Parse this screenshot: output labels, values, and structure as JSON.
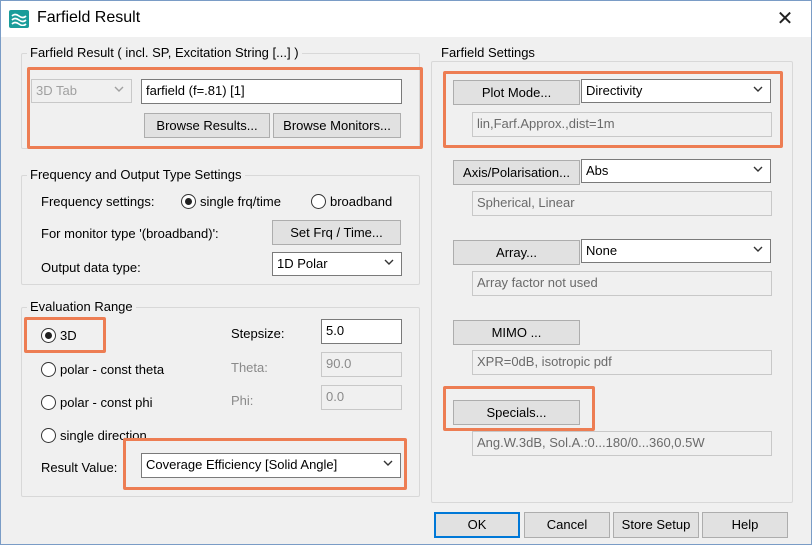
{
  "window": {
    "title": "Farfield Result",
    "app_icon": "wave-icon",
    "close_icon": "close-icon",
    "close_glyph": "✕"
  },
  "farfield_result": {
    "group_title": "Farfield Result ( incl. SP, Excitation String [...] )",
    "tab_combo_value": "3D Tab",
    "result_name": "farfield (f=.81) [1]",
    "browse_results_label": "Browse Results...",
    "browse_monitors_label": "Browse Monitors..."
  },
  "frequency_output": {
    "group_title": "Frequency and Output Type Settings",
    "frequency_label": "Frequency settings:",
    "single_label": "single frq/time",
    "broadband_label": "broadband",
    "single_selected": true,
    "monitor_label": "For monitor type '(broadband)':",
    "set_frq_label": "Set Frq / Time...",
    "output_type_label": "Output data type:",
    "output_type_value": "1D Polar"
  },
  "evaluation_range": {
    "group_title": "Evaluation Range",
    "option_3d": "3D",
    "option_polar_theta": "polar - const theta",
    "option_polar_phi": "polar - const phi",
    "option_single_direction": "single direction",
    "selected": "3D",
    "stepsize_label": "Stepsize:",
    "stepsize_value": "5.0",
    "theta_label": "Theta:",
    "theta_value": "90.0",
    "phi_label": "Phi:",
    "phi_value": "0.0",
    "result_value_label": "Result Value:",
    "result_value": "Coverage Efficiency [Solid Angle]"
  },
  "farfield_settings": {
    "group_title": "Farfield Settings",
    "plot_mode_label": "Plot Mode...",
    "plot_mode_value": "Directivity",
    "plot_mode_summary": "lin,Farf.Approx.,dist=1m",
    "axis_label": "Axis/Polarisation...",
    "axis_value": "Abs",
    "axis_summary": "Spherical, Linear",
    "array_label": "Array...",
    "array_value": "None",
    "array_summary": "Array factor not used",
    "mimo_label": "MIMO ...",
    "mimo_summary": "XPR=0dB, isotropic pdf",
    "specials_label": "Specials...",
    "specials_summary": "Ang.W.3dB, Sol.A.:0...180/0...360,0.5W"
  },
  "footer": {
    "ok_label": "OK",
    "cancel_label": "Cancel",
    "store_setup_label": "Store Setup",
    "help_label": "Help"
  },
  "colors": {
    "highlight": "#ed7d53",
    "dialog_bg": "#f0f0f0",
    "default_button_border": "#0078d7",
    "icon_teal": "#1a9c9a"
  }
}
